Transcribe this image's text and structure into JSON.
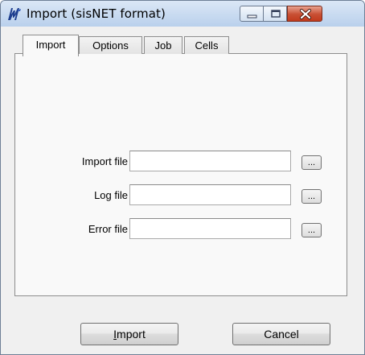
{
  "window": {
    "title": "Import (sisNET format)"
  },
  "titlebar_buttons": {
    "minimize_icon": "minimize-icon",
    "maximize_icon": "maximize-icon",
    "close_icon": "close-icon",
    "close_color": "#c84f33"
  },
  "tabs": [
    {
      "label": "Import",
      "active": true
    },
    {
      "label": "Options",
      "active": false
    },
    {
      "label": "Job",
      "active": false
    },
    {
      "label": "Cells",
      "active": false
    }
  ],
  "fields": {
    "import_file": {
      "label": "Import file",
      "value": "",
      "browse_label": "..."
    },
    "log_file": {
      "label": "Log file",
      "value": "",
      "browse_label": "..."
    },
    "error_file": {
      "label": "Error file",
      "value": "",
      "browse_label": "..."
    }
  },
  "buttons": {
    "import_mnemonic": "I",
    "import_rest": "mport",
    "cancel_label": "Cancel"
  },
  "colors": {
    "titlebar": "#b9d0ec",
    "app_icon": "#1f3f8f"
  }
}
